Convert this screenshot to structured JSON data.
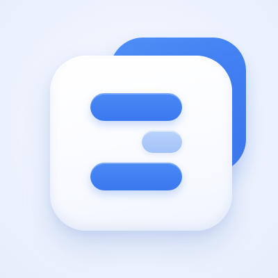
{
  "icon": {
    "name": "app-logo-icon",
    "colors": {
      "background": "#eef3fd",
      "back_card": "#4384f4",
      "front_card": "#fbfcff",
      "bar_primary": "#3f7ff1",
      "bar_secondary": "#acc8f9"
    }
  }
}
